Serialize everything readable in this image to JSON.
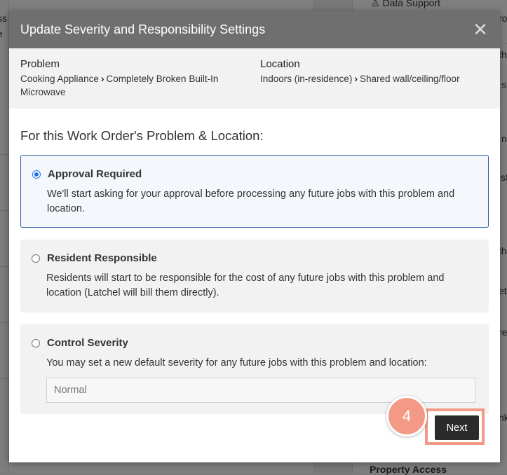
{
  "background": {
    "left_fragments": [
      "ss",
      "e"
    ],
    "right_fragments": {
      "data_support": "Data Support",
      "r1": "ro",
      "r2": "th",
      "r3": "s",
      "r4": "n",
      "r5": "ist",
      "r6": "th",
      "r7": "et",
      "r8": "re",
      "r9": "nk",
      "property_access": "Property Access"
    }
  },
  "modal": {
    "title": "Update Severity and Responsibility Settings",
    "close_glyph": "✕"
  },
  "info": {
    "problem_label": "Problem",
    "problem_category": "Cooking Appliance",
    "problem_item": "Completely Broken Built-In Microwave",
    "location_label": "Location",
    "location_area": "Indoors (in-residence)",
    "location_detail": "Shared wall/ceiling/floor"
  },
  "section_heading": "For this Work Order's Problem & Location:",
  "options": [
    {
      "title": "Approval Required",
      "description": "We'll start asking for your approval before processing any future jobs with this problem and location.",
      "selected": true
    },
    {
      "title": "Resident Responsible",
      "description": "Residents will start to be responsible for the cost of any future jobs with this problem and location (Latchel will bill them directly).",
      "selected": false
    },
    {
      "title": "Control Severity",
      "description": "You may set a new default severity for any future jobs with this problem and location:",
      "selected": false
    }
  ],
  "severity_input": {
    "placeholder": "Normal"
  },
  "step_badge": "4",
  "next_button": "Next",
  "colors": {
    "header_bg": "#6f6f6f",
    "selected_border": "#2d5fa3",
    "highlight": "#f39a86",
    "button_bg": "#2b2b2b"
  }
}
